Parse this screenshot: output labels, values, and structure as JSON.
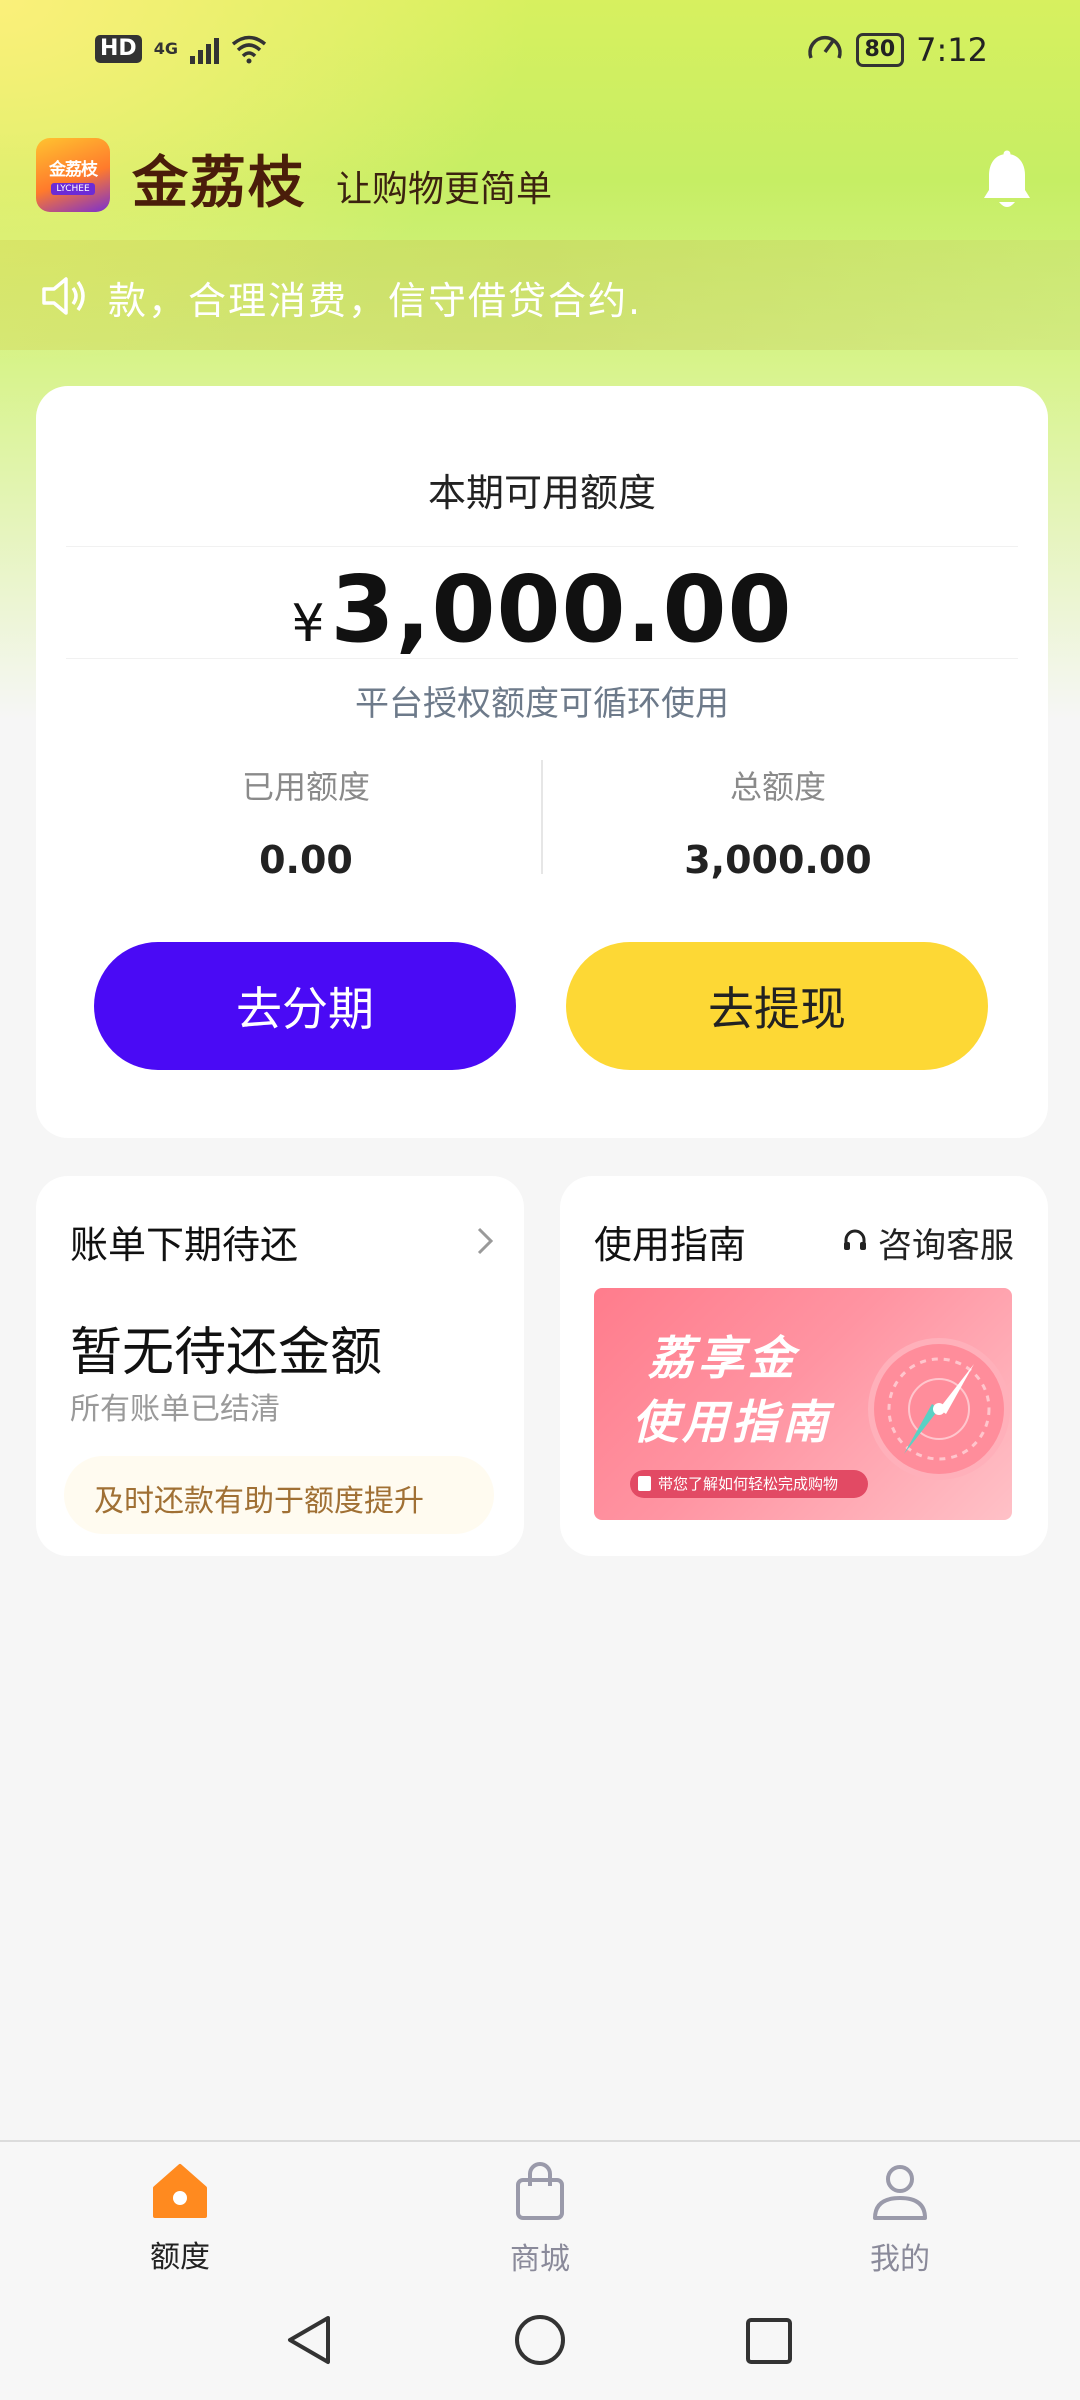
{
  "status_bar": {
    "hd": "HD",
    "network": "4G",
    "battery": "80",
    "time": "7:12"
  },
  "header": {
    "logo_text": "金荔枝",
    "logo_sub": "LYCHEE",
    "app_name": "金荔枝",
    "slogan": "让购物更简单",
    "bell_icon": "bell-icon"
  },
  "notice": {
    "text": "款，合理消费，信守借贷合约.",
    "icon": "speaker-icon"
  },
  "credit_card": {
    "title": "本期可用额度",
    "currency": "¥",
    "amount": "3,000.00",
    "subtitle": "平台授权额度可循环使用",
    "used_label": "已用额度",
    "used_value": "0.00",
    "total_label": "总额度",
    "total_value": "3,000.00",
    "installment_button": "去分期",
    "withdraw_button": "去提现",
    "installment_color": "#4a0af5",
    "withdraw_color": "#fdd835"
  },
  "bill_card": {
    "title": "账单下期待还",
    "main": "暂无待还金额",
    "sub": "所有账单已结清",
    "tip": "及时还款有助于额度提升"
  },
  "guide_card": {
    "title": "使用指南",
    "customer_service": "咨询客服",
    "banner_line1": "荔享金",
    "banner_line2": "使用指南",
    "banner_pill": "带您了解如何轻松完成购物"
  },
  "bottom_nav": {
    "items": [
      {
        "label": "额度",
        "icon": "home-icon",
        "active": true
      },
      {
        "label": "商城",
        "icon": "shopping-bag-icon",
        "active": false
      },
      {
        "label": "我的",
        "icon": "profile-icon",
        "active": false
      }
    ],
    "active_color": "#ff8a1f",
    "inactive_color": "#9a9aaa"
  }
}
